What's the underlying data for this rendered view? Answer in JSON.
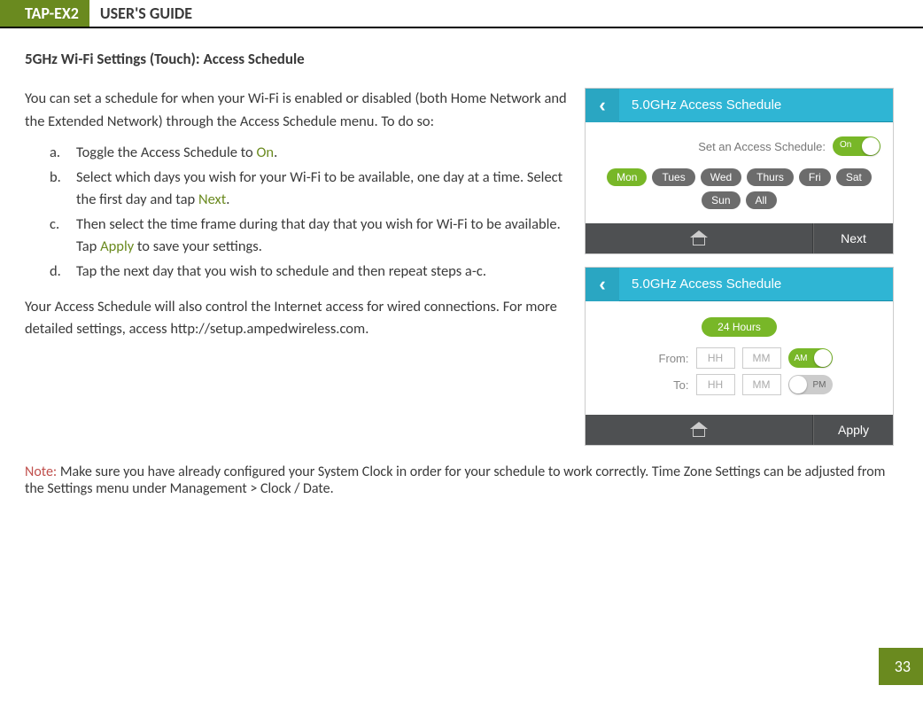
{
  "header": {
    "badge": "TAP-EX2",
    "title": "USER'S GUIDE"
  },
  "section_title": "5GHz Wi-Fi Settings (Touch): Access Schedule",
  "intro": "You can set a schedule for when your Wi-Fi is enabled or disabled (both Home Network and the Extended Network) through the Access Schedule menu. To do so:",
  "steps": {
    "a": {
      "marker": "a.",
      "pre": "Toggle the Access Schedule to ",
      "hl": "On",
      "post": "."
    },
    "b": {
      "marker": "b.",
      "pre": "Select which days you wish for your Wi-Fi to be available, one day at a time. Select the first day and tap ",
      "hl": "Next",
      "post": "."
    },
    "c": {
      "marker": "c.",
      "pre": "Then select the time frame during that day that you wish for Wi-Fi to be available. Tap ",
      "hl": "Apply",
      "post": " to save your settings."
    },
    "d": {
      "marker": "d.",
      "text": "Tap the next day that you wish to schedule and then repeat steps a-c."
    }
  },
  "outro": "Your Access Schedule will also control the Internet access for wired connections. For more detailed settings, access http://setup.ampedwireless.com.",
  "note": {
    "label": "Note:",
    "text": "  Make sure you have already configured your System Clock in order for your schedule to work correctly. Time Zone Settings can be adjusted from the Settings menu under Management > Clock / Date."
  },
  "phone1": {
    "title": "5.0GHz Access Schedule",
    "set_label": "Set an Access Schedule:",
    "toggle_label": "On",
    "days": [
      "Mon",
      "Tues",
      "Wed",
      "Thurs",
      "Fri",
      "Sat",
      "Sun",
      "All"
    ],
    "footer_action": "Next"
  },
  "phone2": {
    "title": "5.0GHz Access Schedule",
    "hours": "24 Hours",
    "from_label": "From:",
    "to_label": "To:",
    "hh": "HH",
    "mm": "MM",
    "am": "AM",
    "pm": "PM",
    "footer_action": "Apply"
  },
  "page_number": "33"
}
